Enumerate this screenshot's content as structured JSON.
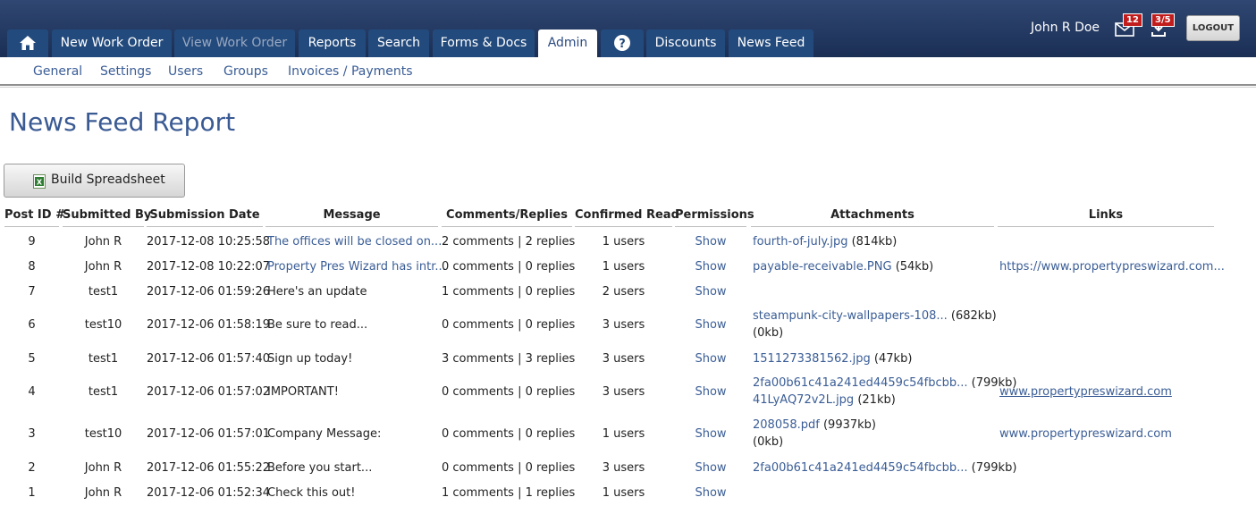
{
  "nav": {
    "home_icon": "home-icon",
    "tabs": [
      {
        "label": "New Work Order"
      },
      {
        "label": "View Work Order"
      },
      {
        "label": "Reports"
      },
      {
        "label": "Search"
      },
      {
        "label": "Forms & Docs"
      },
      {
        "label": "Admin"
      },
      {
        "label": "Discounts"
      },
      {
        "label": "News Feed"
      }
    ],
    "help_icon": "help-icon"
  },
  "user": {
    "name": "John R Doe",
    "messages_badge": "12",
    "downloads_badge": "3/5",
    "logout_label": "LOGOUT"
  },
  "subnav": [
    "General",
    "Settings",
    "Users",
    "Groups",
    "Invoices / Payments"
  ],
  "page": {
    "title": "News Feed Report",
    "build_button": "Build Spreadsheet"
  },
  "table": {
    "headers": [
      "Post ID #",
      "Submitted By",
      "Submission Date",
      "Message",
      "Comments/Replies",
      "Confirmed Read",
      "Permissions",
      "Attachments",
      "Links"
    ],
    "rows": [
      {
        "id": "9",
        "by": "John R",
        "date": "2017-12-08 10:25:58",
        "message": "The offices will be closed on...",
        "message_link": true,
        "comments": "2 comments | 2 replies",
        "read": "1 users",
        "perm": "Show",
        "att": [
          {
            "name": "fourth-of-july.jpg",
            "size": "(814kb)"
          }
        ],
        "link": "",
        "link_ul": false
      },
      {
        "id": "8",
        "by": "John R",
        "date": "2017-12-08 10:22:07",
        "message": "Property Pres Wizard has intr...",
        "message_link": true,
        "comments": "0 comments | 0 replies",
        "read": "1 users",
        "perm": "Show",
        "att": [
          {
            "name": "payable-receivable.PNG",
            "size": "(54kb)"
          }
        ],
        "link": "https://www.propertypreswizard.com...",
        "link_ul": false
      },
      {
        "id": "7",
        "by": "test1",
        "date": "2017-12-06 01:59:26",
        "message": "Here's an update",
        "message_link": false,
        "comments": "1 comments | 0 replies",
        "read": "2 users",
        "perm": "Show",
        "att": [],
        "link": "",
        "link_ul": false
      },
      {
        "id": "6",
        "by": "test10",
        "date": "2017-12-06 01:58:19",
        "message": "Be sure to read...",
        "message_link": false,
        "comments": "0 comments | 0 replies",
        "read": "3 users",
        "perm": "Show",
        "att": [
          {
            "name": "steampunk-city-wallpapers-108...",
            "size": "(682kb)"
          },
          {
            "name": "",
            "size": "(0kb)"
          }
        ],
        "link": "",
        "link_ul": false
      },
      {
        "id": "5",
        "by": "test1",
        "date": "2017-12-06 01:57:40",
        "message": "Sign up today!",
        "message_link": false,
        "comments": "3 comments | 3 replies",
        "read": "3 users",
        "perm": "Show",
        "att": [
          {
            "name": "1511273381562.jpg",
            "size": "(47kb)"
          }
        ],
        "link": "",
        "link_ul": false
      },
      {
        "id": "4",
        "by": "test1",
        "date": "2017-12-06 01:57:02",
        "message": "IMPORTANT!",
        "message_link": false,
        "comments": "0 comments | 0 replies",
        "read": "3 users",
        "perm": "Show",
        "att": [
          {
            "name": "2fa00b61c41a241ed4459c54fbcbb...",
            "size": "(799kb)"
          },
          {
            "name": "41LyAQ72v2L.jpg",
            "size": "(21kb)"
          }
        ],
        "link": "www.propertypreswizard.com",
        "link_ul": true
      },
      {
        "id": "3",
        "by": "test10",
        "date": "2017-12-06 01:57:01",
        "message": "Company Message:",
        "message_link": false,
        "comments": "0 comments | 0 replies",
        "read": "1 users",
        "perm": "Show",
        "att": [
          {
            "name": "208058.pdf",
            "size": "(9937kb)"
          },
          {
            "name": "",
            "size": "(0kb)"
          }
        ],
        "link": "www.propertypreswizard.com",
        "link_ul": false
      },
      {
        "id": "2",
        "by": "John R",
        "date": "2017-12-06 01:55:22",
        "message": "Before you start...",
        "message_link": false,
        "comments": "0 comments | 0 replies",
        "read": "3 users",
        "perm": "Show",
        "att": [
          {
            "name": "2fa00b61c41a241ed4459c54fbcbb...",
            "size": "(799kb)"
          }
        ],
        "link": "",
        "link_ul": false
      },
      {
        "id": "1",
        "by": "John R",
        "date": "2017-12-06 01:52:34",
        "message": "Check this out!",
        "message_link": false,
        "comments": "1 comments | 1 replies",
        "read": "1 users",
        "perm": "Show",
        "att": [],
        "link": "",
        "link_ul": false
      }
    ]
  }
}
